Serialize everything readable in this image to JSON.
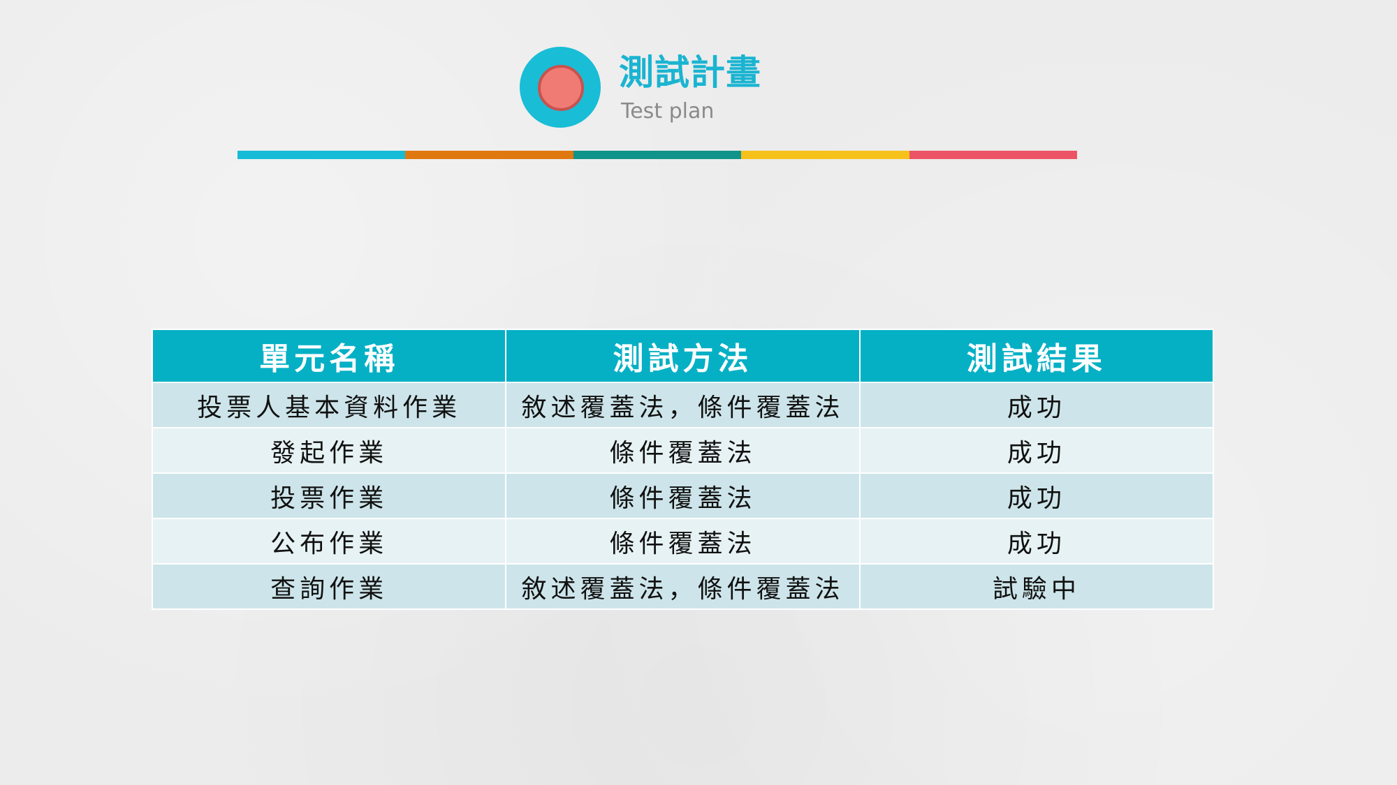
{
  "header": {
    "title": "測試計畫",
    "subtitle": "Test plan",
    "icon": "circle-target-icon",
    "color_bar": [
      "#16bcd6",
      "#e07810",
      "#10938a",
      "#f6c21a",
      "#ec5466"
    ]
  },
  "table": {
    "headers": [
      "單元名稱",
      "測試方法",
      "測試結果"
    ],
    "rows": [
      [
        "投票人基本資料作業",
        "敘述覆蓋法，條件覆蓋法",
        "成功"
      ],
      [
        "發起作業",
        "條件覆蓋法",
        "成功"
      ],
      [
        "投票作業",
        "條件覆蓋法",
        "成功"
      ],
      [
        "公布作業",
        "條件覆蓋法",
        "成功"
      ],
      [
        "查詢作業",
        "敘述覆蓋法，條件覆蓋法",
        "試驗中"
      ]
    ]
  }
}
